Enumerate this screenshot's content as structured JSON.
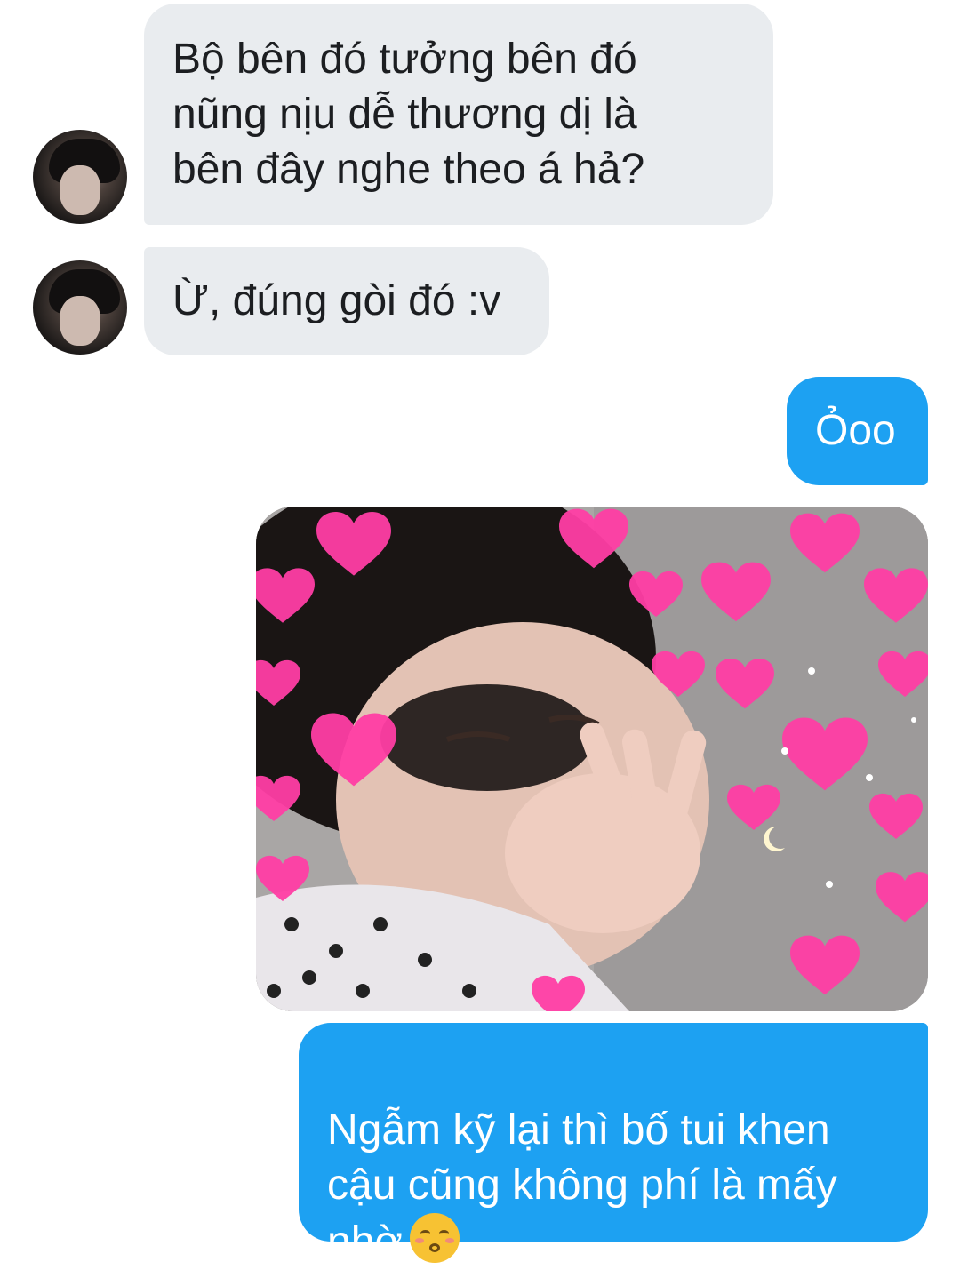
{
  "conversation": {
    "messages": [
      {
        "sender": "them",
        "type": "text",
        "text": "Bộ bên đó tưởng bên đó\nnũng nịu dễ thương dị là\nbên đây nghe theo á hả?"
      },
      {
        "sender": "them",
        "type": "text",
        "text": "Ừ, đúng gòi đó :v"
      },
      {
        "sender": "me",
        "type": "text",
        "text": "Ỏoo"
      },
      {
        "sender": "me",
        "type": "image",
        "image": "child-with-hearts-photo"
      },
      {
        "sender": "me",
        "type": "text",
        "text": "Ngẫm kỹ lại thì bố tui khen\ncậu cũng không phí là mấy\nnhờ",
        "emoji": "kissing-smiling-eyes-emoji"
      }
    ]
  },
  "colors": {
    "incoming_bubble": "#e9ecef",
    "outgoing_bubble": "#1da1f2",
    "incoming_text": "#1c1e21",
    "outgoing_text": "#ffffff",
    "heart": "#ff3ea5"
  }
}
